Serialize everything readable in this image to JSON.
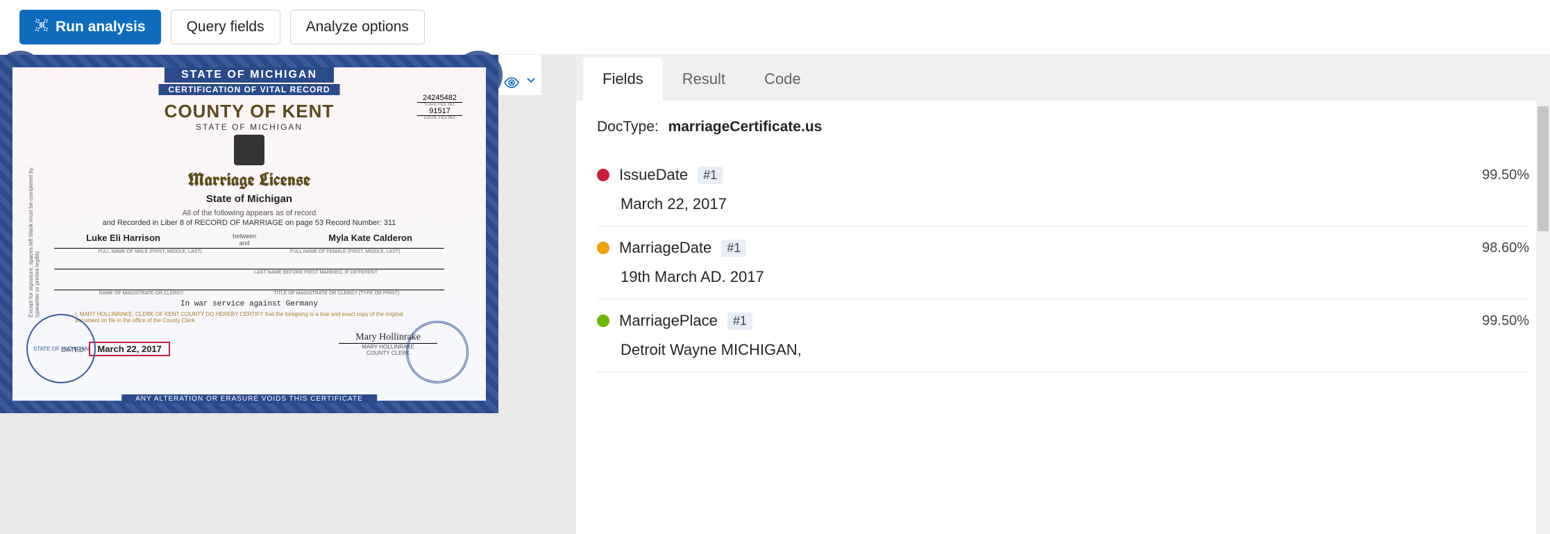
{
  "toolbar": {
    "run": "Run analysis",
    "query": "Query fields",
    "options": "Analyze options"
  },
  "certificate": {
    "ribbonTop": "STATE OF MICHIGAN",
    "ribbonSub": "CERTIFICATION OF VITAL RECORD",
    "ribbonBottom": "ANY ALTERATION OR ERASURE VOIDS THIS CERTIFICATE",
    "county": "COUNTY OF KENT",
    "stateSmall": "STATE OF MICHIGAN",
    "title": "Marriage License",
    "stateMid": "State of Michigan",
    "stateFileNo": "24245482",
    "localFileNo": "91517",
    "recordText": "All of the following appears as of record",
    "recordLine": "and Recorded in Liber 8 of RECORD OF MARRIAGE on page 53  Record Number: 311",
    "between": "between",
    "and": "and",
    "maleName": "Luke Eli Harrison",
    "femaleName": "Myla Kate Calderon",
    "maleLabel": "FULL NAME OF MALE (FIRST, MIDDLE, LAST)",
    "femaleLabel": "FULL NAME OF FEMALE (FIRST, MIDDLE, LAST)",
    "lastNameLabel": "LAST NAME BEFORE FIRST MARRIED, IF DIFFERENT",
    "magistrateLabel": "NAME OF MAGISTRATE OR CLERGY",
    "magistrateTitleLabel": "TITLE OF MAGISTRATE OR CLERGY (TYPE OR PRINT)",
    "warLine": "In war service against Germany",
    "certify": "I, MARY HOLLINRAKE, CLERK OF KENT COUNTY DO HEREBY CERTIFY that the foregoing is a true and exact copy of the original document on file in the office of the County Clerk.",
    "datedLabel": "DATED:",
    "date": "March 22, 2017",
    "sigName": "Mary Hollinrake",
    "sigPrinted": "MARY HOLLINRAKE",
    "sigTitle": "COUNTY CLERK",
    "sideText": "Except for signature, spaces left blank must be completed by typewriter or printed legibly",
    "sealText": "STATE OF MICHIGAN"
  },
  "tabs": {
    "fields": "Fields",
    "result": "Result",
    "code": "Code"
  },
  "doctype": {
    "label": "DocType:",
    "value": "marriageCertificate.us"
  },
  "fields": [
    {
      "color": "#c41e3a",
      "name": "IssueDate",
      "badge": "#1",
      "conf": "99.50%",
      "value": "March 22, 2017"
    },
    {
      "color": "#f2a100",
      "name": "MarriageDate",
      "badge": "#1",
      "conf": "98.60%",
      "value": "19th March AD. 2017"
    },
    {
      "color": "#6bb700",
      "name": "MarriagePlace",
      "badge": "#1",
      "conf": "99.50%",
      "value": "Detroit Wayne MICHIGAN,"
    }
  ]
}
